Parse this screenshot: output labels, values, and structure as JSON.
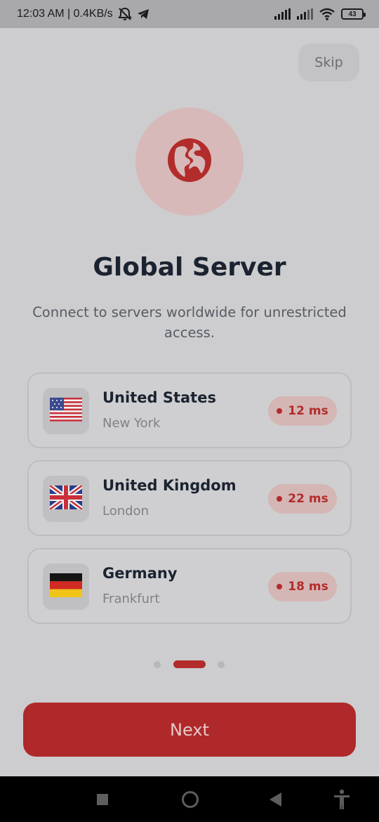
{
  "status_bar": {
    "time_speed": "12:03 AM | 0.4KB/s",
    "battery": "43",
    "icons": [
      "muted-bell-icon",
      "telegram-icon",
      "signal-icon",
      "signal-icon",
      "wifi-icon",
      "battery-icon"
    ]
  },
  "skip_label": "Skip",
  "hero": {
    "icon": "globe-icon",
    "accent_color": "#b22c2b"
  },
  "title": "Global Server",
  "subtitle": "Connect to servers worldwide for unrestricted access.",
  "servers": [
    {
      "country": "United States",
      "city": "New York",
      "ping": "12 ms",
      "flag": "us-flag-icon"
    },
    {
      "country": "United Kingdom",
      "city": "London",
      "ping": "22 ms",
      "flag": "uk-flag-icon"
    },
    {
      "country": "Germany",
      "city": "Frankfurt",
      "ping": "18 ms",
      "flag": "germany-flag-icon"
    }
  ],
  "pager": {
    "total": 3,
    "active": 2
  },
  "next_label": "Next",
  "nav_bar": {
    "icons": [
      "recents-square-icon",
      "home-circle-icon",
      "back-triangle-icon",
      "accessibility-icon"
    ]
  }
}
